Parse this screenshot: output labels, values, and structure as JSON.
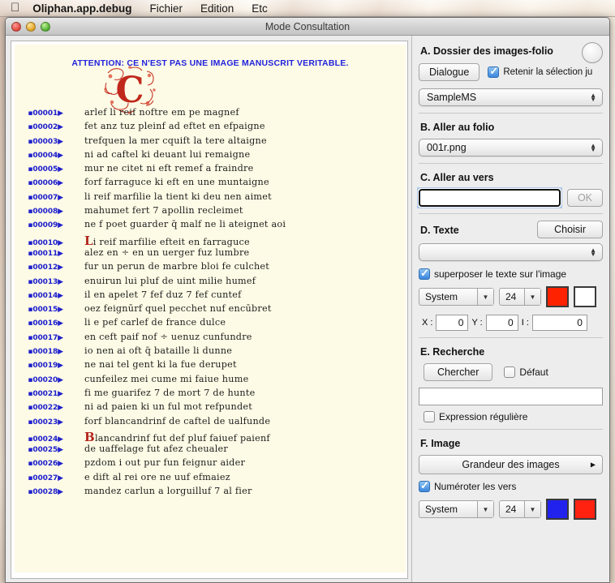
{
  "menubar": {
    "apple_icon": "apple-logo",
    "app_name": "Oliphan.app.debug",
    "items": [
      "Fichier",
      "Edition",
      "Etc"
    ]
  },
  "window": {
    "title": "Mode Consultation"
  },
  "document": {
    "warning": "ATTENTION: CE N'EST PAS UNE IMAGE MANUSCRIT VERITABLE.",
    "drop_cap": "C",
    "lines": [
      {
        "num": "00001",
        "text": "arlef li reif noftre em pe magnef"
      },
      {
        "num": "00002",
        "text": "fet anz tuz pleinf ad eftet en efpaigne"
      },
      {
        "num": "00003",
        "text": "trefquen la mer cquift la tere altaigne"
      },
      {
        "num": "00004",
        "text": "ni ad caftel ki deuant lui remaigne"
      },
      {
        "num": "00005",
        "text": "mur ne citet ni eft remef a fraindre"
      },
      {
        "num": "00006",
        "text": "forf farraguce ki eft en une muntaigne"
      },
      {
        "num": "00007",
        "text": "li reif marfilie la tient ki deu nen aimet"
      },
      {
        "num": "00008",
        "text": "mahumet fert 7 apollin recleimet"
      },
      {
        "num": "00009",
        "text": "ne f poet guarder q̄ malf ne li ateignet aoi"
      },
      {
        "num": "00010",
        "text": "i reif marfilie efteit en farraguce",
        "rubric": "L"
      },
      {
        "num": "00011",
        "text": "alez en ÷ en un uerger fuz lumbre"
      },
      {
        "num": "00012",
        "text": "fur un perun de marbre bloi fe culchet"
      },
      {
        "num": "00013",
        "text": "enuirun lui pluf de uint milie humef"
      },
      {
        "num": "00014",
        "text": "il en apelet 7 fef duz 7 fef cuntef"
      },
      {
        "num": "00015",
        "text": "oez feignūrf quel pecchet nuf encūbret"
      },
      {
        "num": "00016",
        "text": "li e pef carlef de france dulce"
      },
      {
        "num": "00017",
        "text": "en ceft paif nof ÷ uenuz cunfundre"
      },
      {
        "num": "00018",
        "text": "io nen ai oft q̄ bataille li dunne"
      },
      {
        "num": "00019",
        "text": "ne nai tel gent ki la fue derupet"
      },
      {
        "num": "00020",
        "text": "cunfeilez mei cume mi faiue hume"
      },
      {
        "num": "00021",
        "text": "fi me guarifez 7 de mort 7 de hunte"
      },
      {
        "num": "00022",
        "text": "ni ad paien ki un ful mot refpundet"
      },
      {
        "num": "00023",
        "text": "forf blancandrinf de caftel de ualfunde"
      },
      {
        "num": "00024",
        "text": "lancandrinf fut def pluf faiuef paienf",
        "rubric": "B"
      },
      {
        "num": "00025",
        "text": "de uaffelage fut afez cheualer"
      },
      {
        "num": "00026",
        "text": "pzdom i out pur fun feignur aider"
      },
      {
        "num": "00027",
        "text": "e dift al rei ore ne uuf efmaiez"
      },
      {
        "num": "00028",
        "text": "mandez carlun a lorguilluf 7 al fier"
      }
    ]
  },
  "panel": {
    "section_a": {
      "title": "A. Dossier des images-folio",
      "circle_button": "spinner-button",
      "dialogue_button": "Dialogue",
      "retain_checkbox": {
        "label": "Retenir la sélection ju",
        "checked": true
      },
      "folder_popup": "SampleMS"
    },
    "section_b": {
      "title": "B. Aller au folio",
      "folio_popup": "001r.png"
    },
    "section_c": {
      "title": "C. Aller au vers",
      "verse_input": "",
      "verse_placeholder": "",
      "ok_button": "OK",
      "ok_enabled": false
    },
    "section_d": {
      "title": "D. Texte",
      "choose_button": "Choisir",
      "text_popup": "",
      "overlay_checkbox": {
        "label": "superposer le texte sur l'image",
        "checked": true
      },
      "font_combo": "System",
      "size_combo": "24",
      "color_primary": "#ff2200",
      "color_secondary": "#ffffff",
      "x_label": "X :",
      "x_value": "0",
      "y_label": "Y :",
      "y_value": "0",
      "i_label": "I :",
      "i_value": "0"
    },
    "section_e": {
      "title": "E. Recherche",
      "search_button": "Chercher",
      "default_checkbox": {
        "label": "Défaut",
        "checked": false
      },
      "search_input": "",
      "regex_checkbox": {
        "label": "Expression régulière",
        "checked": false
      }
    },
    "section_f": {
      "title": "F. Image",
      "size_button": "Grandeur des images",
      "number_checkbox": {
        "label": "Numéroter les vers",
        "checked": true
      },
      "font_combo": "System",
      "size_combo": "24",
      "color_primary": "#2222ee",
      "color_secondary": "#ff2211"
    }
  }
}
